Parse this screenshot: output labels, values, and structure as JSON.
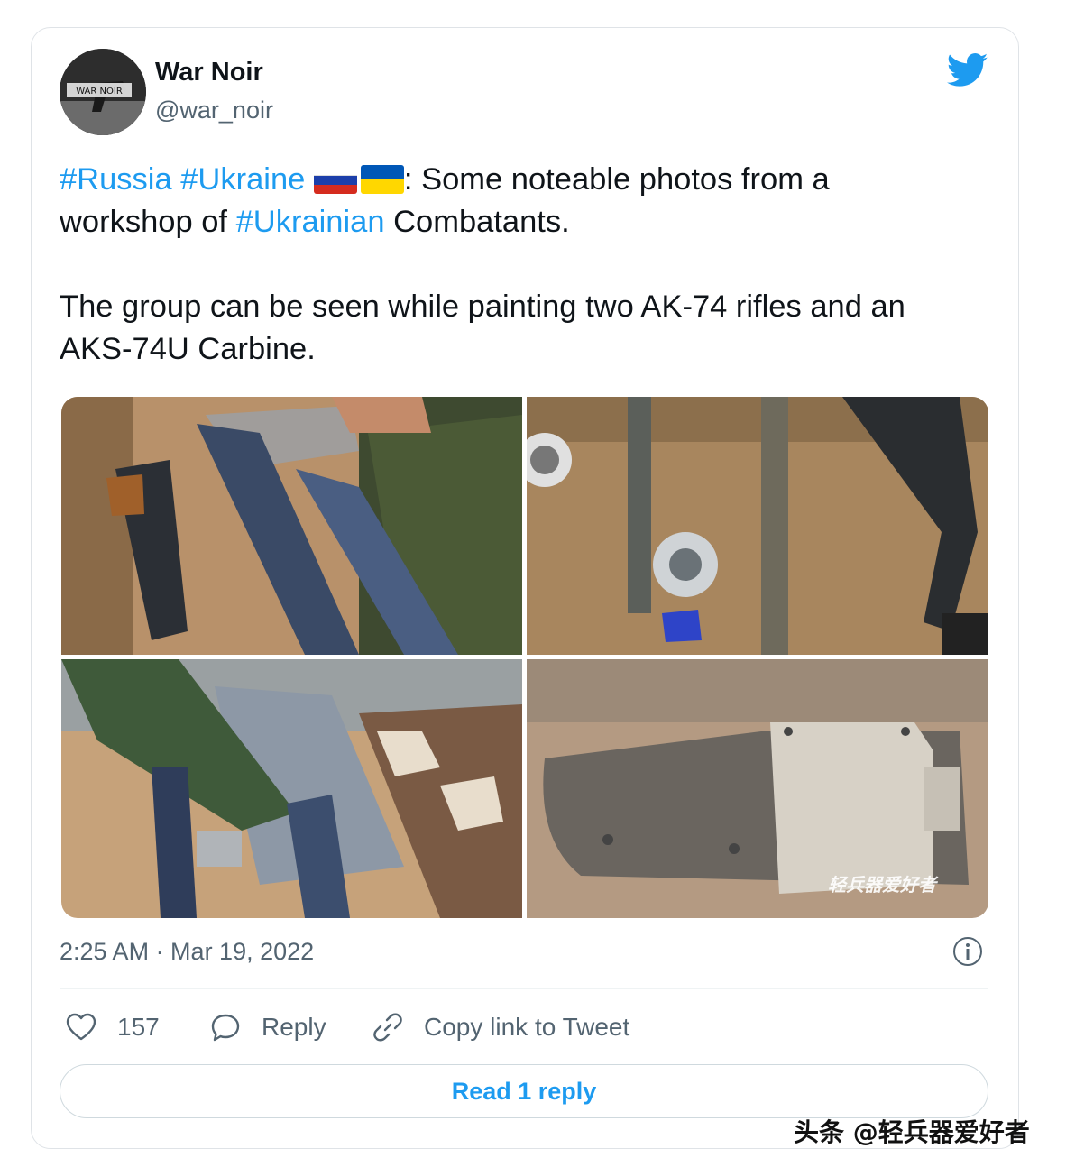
{
  "author": {
    "name": "War Noir",
    "handle": "@war_noir",
    "avatar_text": "WAR NOIR"
  },
  "tweet": {
    "line1": {
      "tag1": "#Russia",
      "tag2": "#Ukraine",
      "after_flags": ": Some noteable photos from a"
    },
    "line2": {
      "before": "workshop of ",
      "tag": "#Ukrainian",
      "after": " Combatants."
    },
    "para2": "The group can be seen while painting two AK-74 rifles and an AKS-74U Carbine."
  },
  "media": {
    "photo4_watermark": "轻兵器爱好者"
  },
  "timestamp": "2:25 AM · Mar 19, 2022",
  "actions": {
    "like_count": "157",
    "reply_label": "Reply",
    "copy_label": "Copy link to Tweet"
  },
  "read_replies_label": "Read 1 reply",
  "page_watermark": "头条 @轻兵器爱好者",
  "colors": {
    "accent": "#1d9bf0",
    "secondary_text": "#536471",
    "flag_russia": [
      "#ffffff",
      "#1c3faa",
      "#d52b1e"
    ],
    "flag_ukraine": [
      "#0057b7",
      "#ffd700"
    ]
  },
  "icons": {
    "brand": "twitter-bird-icon",
    "info": "info-icon",
    "like": "heart-icon",
    "reply": "speech-bubble-icon",
    "copy": "link-icon"
  }
}
